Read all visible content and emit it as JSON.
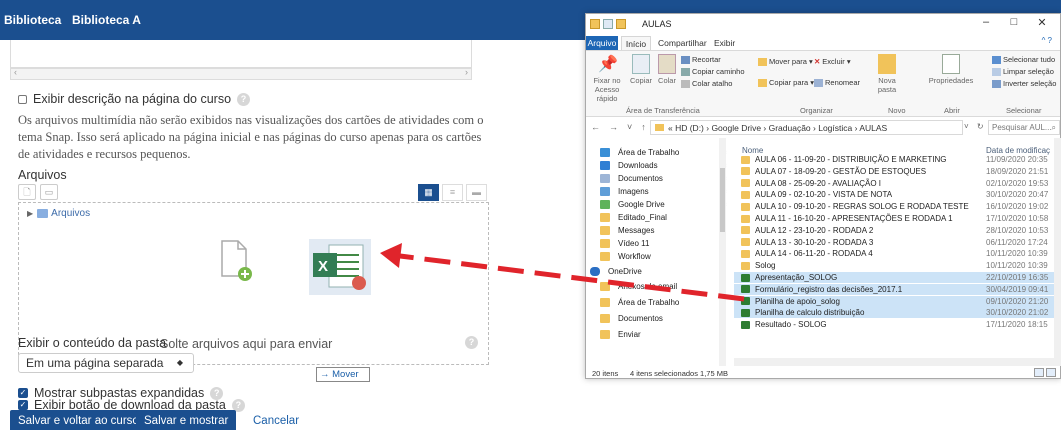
{
  "moodle": {
    "tabs": [
      "Biblioteca",
      "Biblioteca A"
    ],
    "show_description_label": "Exibir descrição na página do curso",
    "multimedia_text": "Os arquivos multimídia não serão exibidos nas visualizações dos cartões de atividades com o tema Snap. Isso será aplicado na página inicial e nas páginas do curso apenas para os cartões de atividades e recursos pequenos.",
    "files_label": "Arquivos",
    "folder_link": "Arquivos",
    "drop_text": "Solte arquivos aqui para enviar",
    "move_badge": "→ Mover",
    "show_folder_contents_label": "Exibir o conteúdo da pasta",
    "show_folder_contents_value": "Em uma página separada",
    "show_subfolders_label": "Mostrar subpastas expandidas",
    "show_download_label": "Exibir botão de download da pasta",
    "save_return_label": "Salvar e voltar ao curso",
    "save_show_label": "Salvar e mostrar",
    "cancel_label": "Cancelar",
    "brand_color": "#1b4f8f"
  },
  "explorer": {
    "title": "AULAS",
    "controls": [
      "–",
      "□",
      "✕"
    ],
    "ribbon_tabs": [
      "Arquivo",
      "Início",
      "Compartilhar",
      "Exibir"
    ],
    "ribbon": {
      "pin_label": "Fixar no Acesso rápido",
      "copy_label": "Copiar",
      "paste_label": "Colar",
      "cut_label": "Recortar",
      "copy_path_label": "Copiar caminho",
      "paste_shortcut_label": "Colar atalho",
      "group_clipboard": "Área de Transferência",
      "move_to_label": "Mover para ▾",
      "copy_to_label": "Copiar para ▾",
      "delete_label": "Excluir ▾",
      "rename_label": "Renomear",
      "group_organize": "Organizar",
      "new_folder_label": "Nova pasta",
      "group_new": "Novo",
      "properties_label": "Propriedades",
      "group_open": "Abrir",
      "select_all_label": "Selecionar tudo",
      "clear_selection_label": "Limpar seleção",
      "invert_selection_label": "Inverter seleção",
      "group_select": "Selecionar"
    },
    "address_path": "«  HD (D:)  ›  Google Drive  ›  Graduação  ›  Logística  ›  AULAS",
    "search_placeholder": "Pesquisar AUL...",
    "nav_items": [
      "Área de Trabalho",
      "Downloads",
      "Documentos",
      "Imagens",
      "Google Drive",
      "Editado_Final",
      "Messages",
      "Vídeo 11",
      "Workflow",
      "OneDrive",
      "Anexos de email",
      "Área de Trabalho",
      "Documentos",
      "Enviar"
    ],
    "col_name": "Nome",
    "col_date": "Data de modificaç",
    "files": [
      {
        "name": "AULA 06 - 11-09-20 - DISTRIBUIÇÃO E MARKETING",
        "date": "11/09/2020 20:35",
        "selected": false,
        "type": "folder"
      },
      {
        "name": "AULA 07 - 18-09-20 - GESTÃO DE ESTOQUES",
        "date": "18/09/2020 21:51",
        "selected": false,
        "type": "folder"
      },
      {
        "name": "AULA 08 - 25-09-20 - AVALIAÇÃO I",
        "date": "02/10/2020 19:53",
        "selected": false,
        "type": "folder"
      },
      {
        "name": "AULA 09 - 02-10-20 - VISTA DE NOTA",
        "date": "30/10/2020 20:47",
        "selected": false,
        "type": "folder"
      },
      {
        "name": "AULA 10 - 09-10-20 - REGRAS SOLOG E RODADA TESTE",
        "date": "16/10/2020 19:02",
        "selected": false,
        "type": "folder"
      },
      {
        "name": "AULA 11 - 16-10-20 - APRESENTAÇÕES E RODADA 1",
        "date": "17/10/2020 10:58",
        "selected": false,
        "type": "folder"
      },
      {
        "name": "AULA 12 - 23-10-20 - RODADA 2",
        "date": "28/10/2020 10:53",
        "selected": false,
        "type": "folder"
      },
      {
        "name": "AULA 13 - 30-10-20 - RODADA 3",
        "date": "06/11/2020 17:24",
        "selected": false,
        "type": "folder"
      },
      {
        "name": "AULA 14 - 06-11-20 - RODADA 4",
        "date": "10/11/2020 10:39",
        "selected": false,
        "type": "folder"
      },
      {
        "name": "Solog",
        "date": "10/11/2020 10:39",
        "selected": false,
        "type": "folder"
      },
      {
        "name": "Apresentação_SOLOG",
        "date": "22/10/2019 16:35",
        "selected": true,
        "type": "xls"
      },
      {
        "name": "Formulário_registro das decisões_2017.1",
        "date": "30/04/2019 09:41",
        "selected": true,
        "type": "xls"
      },
      {
        "name": "Planilha de apoio_solog",
        "date": "09/10/2020 21:20",
        "selected": true,
        "type": "xls"
      },
      {
        "name": "Planilha de calculo distribuição",
        "date": "30/10/2020 21:02",
        "selected": true,
        "type": "xls"
      },
      {
        "name": "Resultado - SOLOG",
        "date": "17/11/2020 18:15",
        "selected": false,
        "type": "xls"
      }
    ],
    "status_items": "20 itens",
    "status_selected": "4 itens selecionados  1,75 MB"
  }
}
